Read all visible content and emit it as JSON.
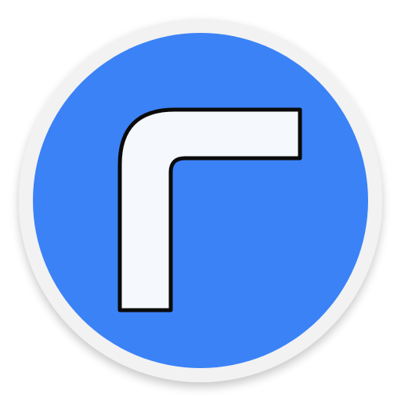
{
  "icon": {
    "name": "corner-bend-icon",
    "colors": {
      "outer_ring": "#f2f2f2",
      "ring_shadow": "#d9d9d9",
      "disc": "#3b82f6",
      "glyph_fill": "#f5f8fd",
      "glyph_stroke": "#0b0b0b"
    }
  }
}
